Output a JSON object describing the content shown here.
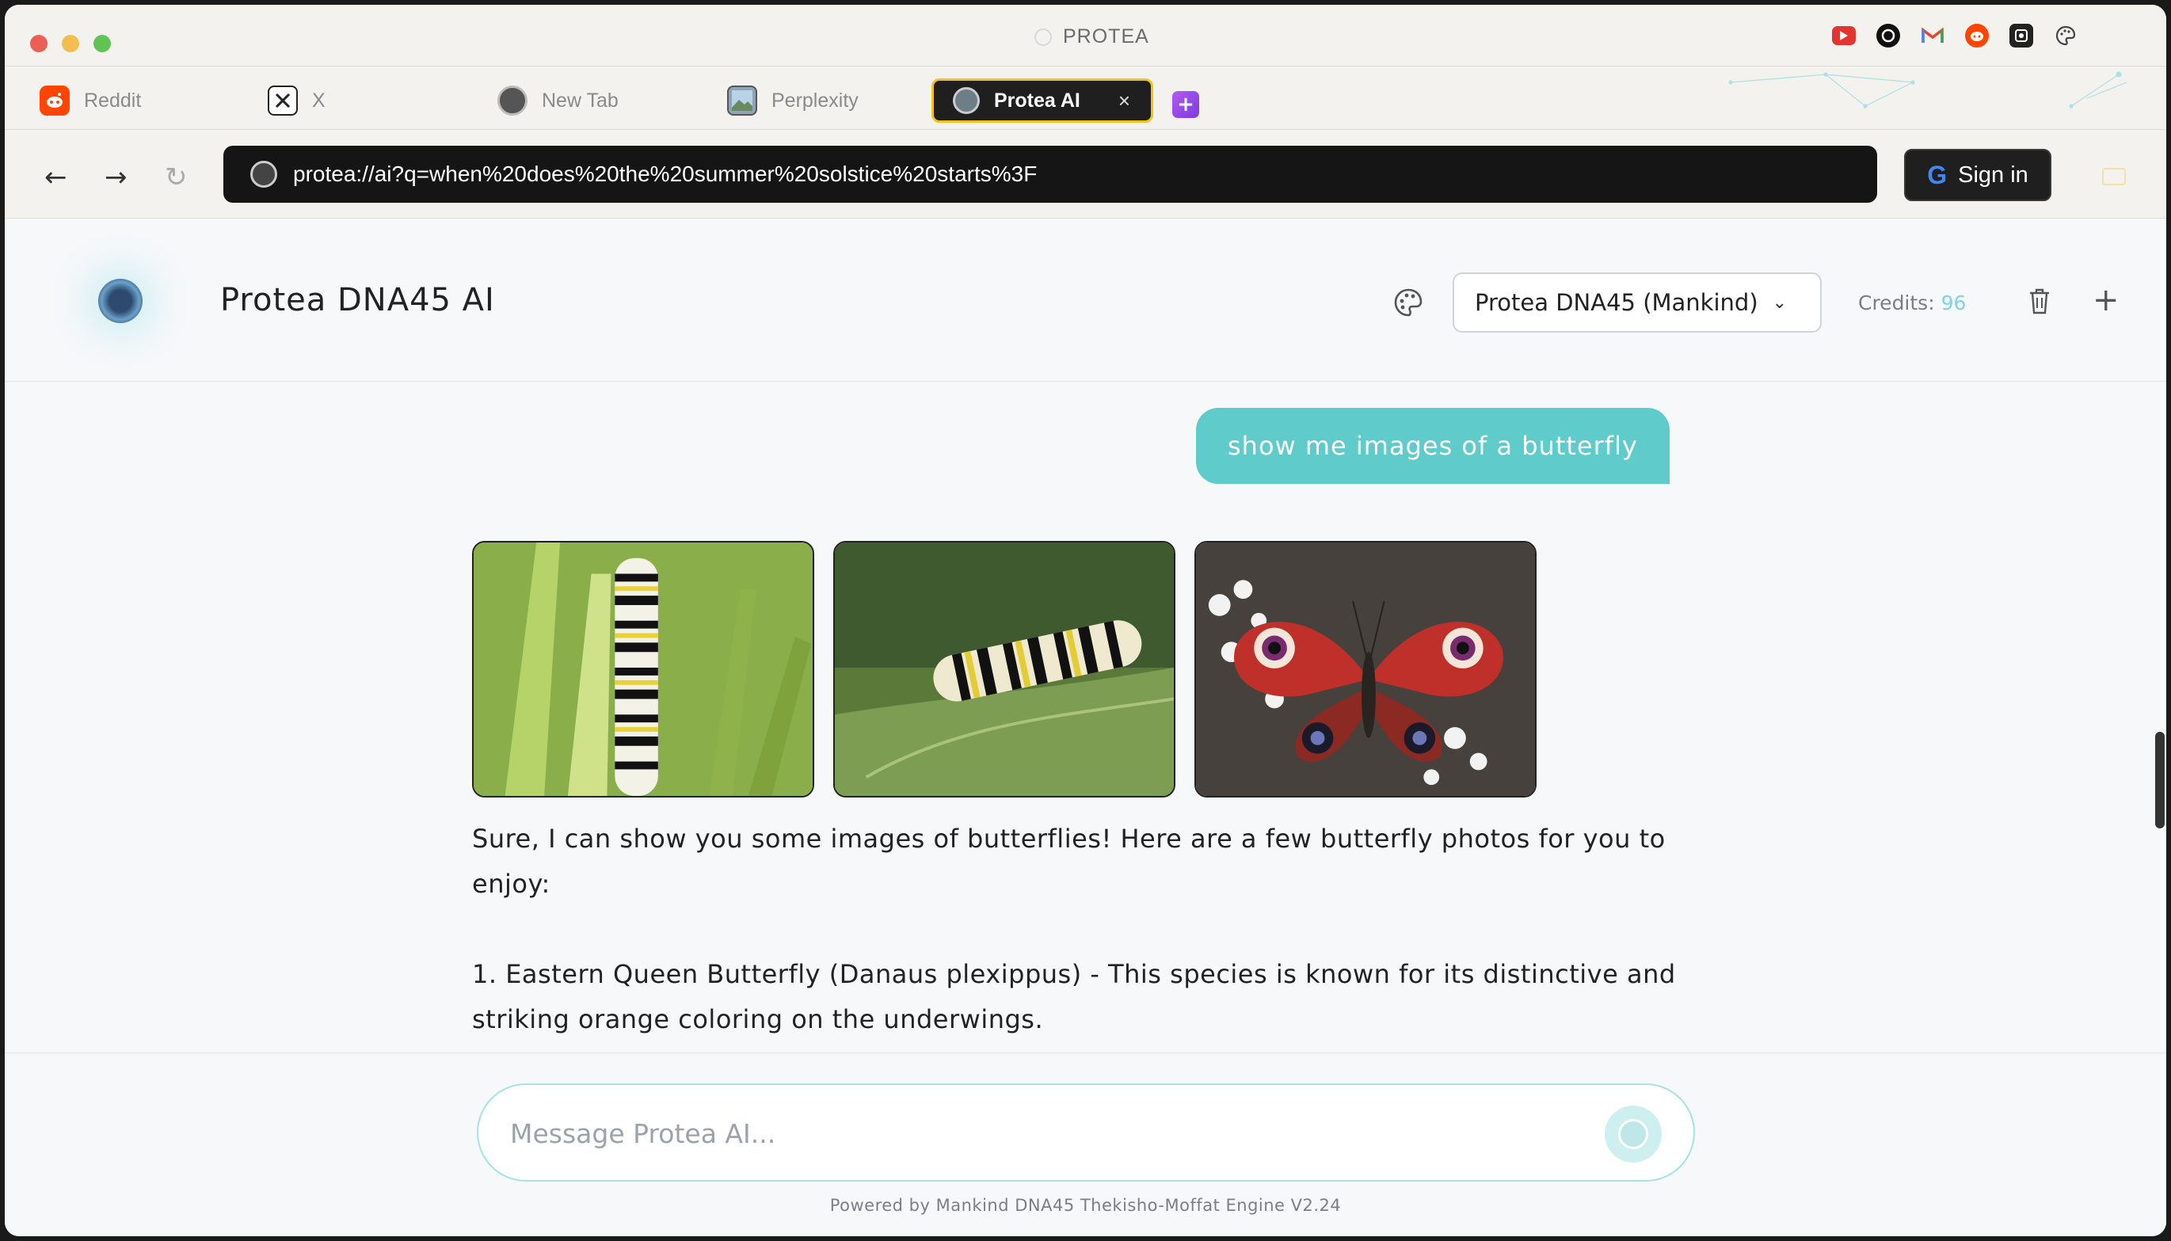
{
  "window": {
    "title": "PROTEA"
  },
  "extensions": [
    "youtube-icon",
    "chatgpt-icon",
    "gmail-icon",
    "reddit-icon",
    "camera-icon",
    "palette-icon"
  ],
  "tabs": [
    {
      "label": "Reddit",
      "icon": "reddit-icon"
    },
    {
      "label": "X",
      "icon": "x-icon"
    },
    {
      "label": "New Tab",
      "icon": "protea-icon"
    },
    {
      "label": "Perplexity",
      "icon": "image-icon"
    },
    {
      "label": "Protea AI",
      "icon": "protea-icon",
      "active": true,
      "close": "×"
    }
  ],
  "addressbar": {
    "url": "protea://ai?q=when%20does%20the%20summer%20solstice%20starts%3F",
    "signin_label": "Sign in",
    "google_glyph": "G"
  },
  "header": {
    "title": "Protea DNA45 AI",
    "model": "Protea DNA45 (Mankind)",
    "credits_label": "Credits:",
    "credits_value": "96",
    "new_chat_glyph": "+"
  },
  "chat": {
    "user_message": "show me images of a butterfly",
    "images": [
      {
        "subject": "monarch-caterpillar-on-milkweed"
      },
      {
        "subject": "monarch-caterpillar-on-leaf"
      },
      {
        "subject": "peacock-butterfly-on-flowers"
      }
    ],
    "assistant_paragraphs": [
      "Sure, I can show you some images of butterflies! Here are a few butterfly photos for you to enjoy:",
      "1. Eastern Queen Butterfly (Danaus plexippus) - This species is known for its distinctive and striking orange coloring on the underwings."
    ]
  },
  "composer": {
    "placeholder": "Message Protea AI...",
    "footer": "Powered by Mankind DNA45 Thekisho-Moffat Engine V2.24"
  },
  "colors": {
    "accent": "#5fcbcb",
    "active_tab_border": "#f2c21b",
    "credits_value": "#7fd5dd"
  }
}
